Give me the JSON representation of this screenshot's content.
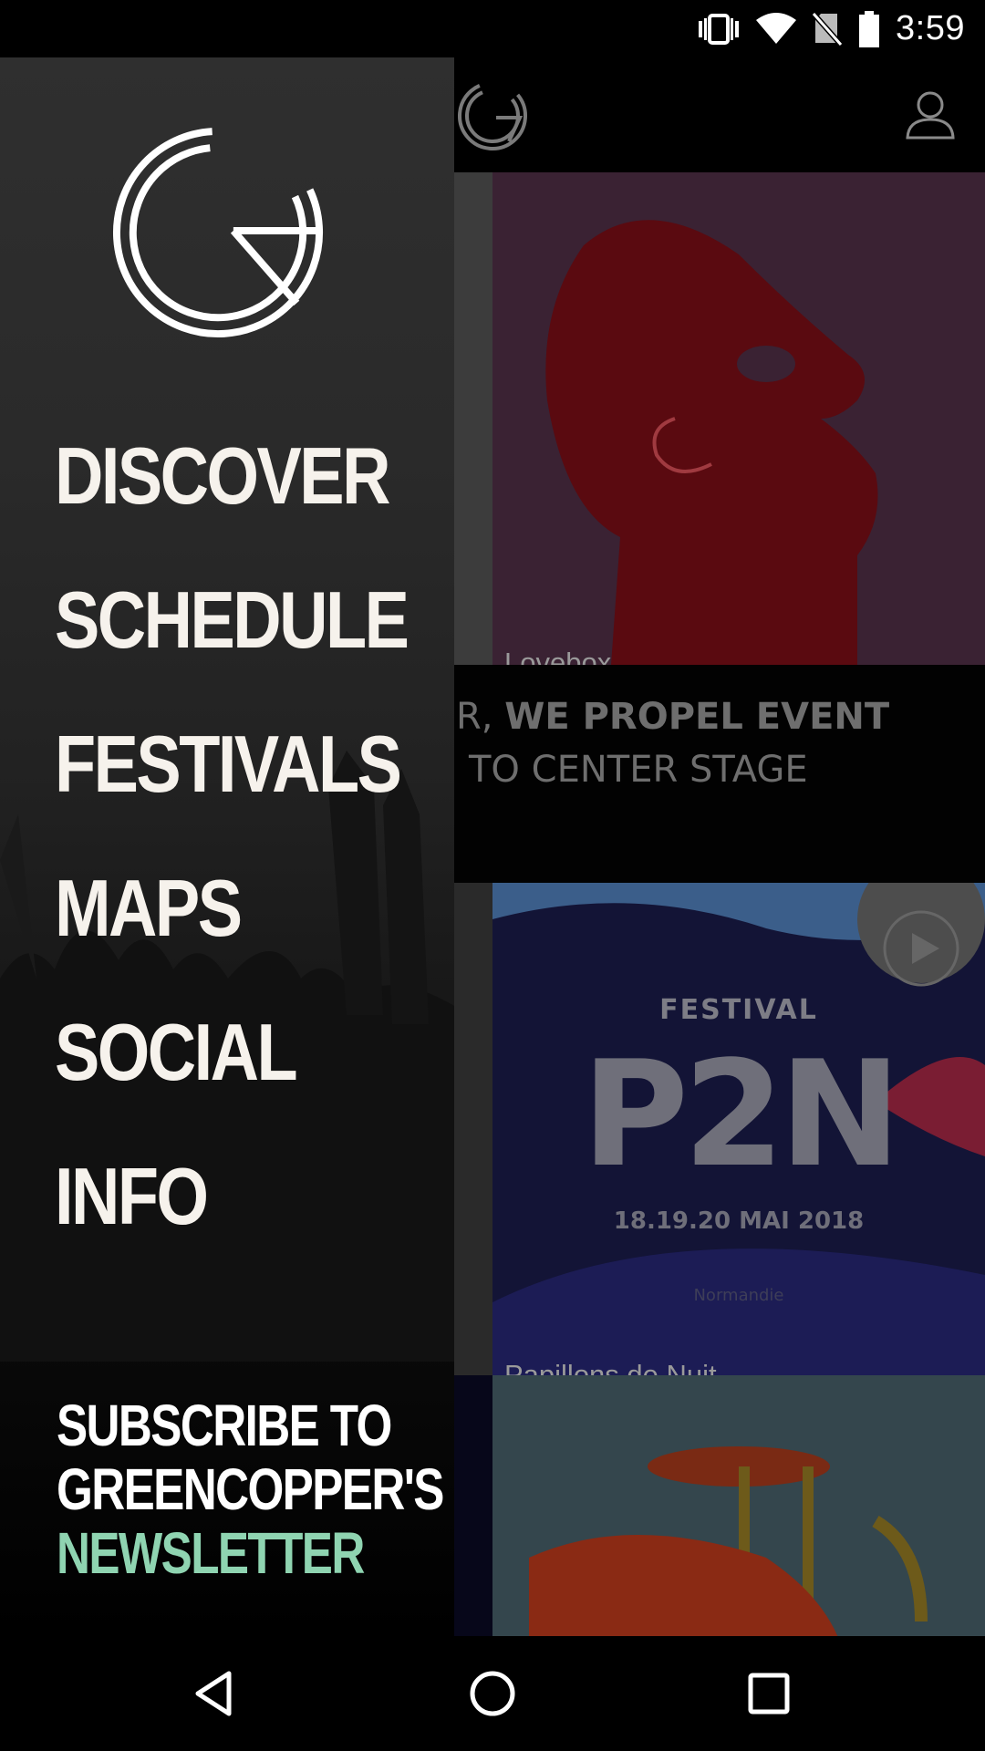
{
  "status_bar": {
    "time": "3:59",
    "icons": [
      "vibrate-icon",
      "wifi-icon",
      "no-sim-icon",
      "battery-icon"
    ]
  },
  "app": {
    "header": {
      "logo": "greencopper-logo",
      "profile_icon": "profile-icon"
    },
    "cards": [
      {
        "label": "Lovebox"
      },
      {
        "label": "Papillons de Nuit",
        "play_icon": "play-icon"
      }
    ],
    "banner": {
      "line1_light": "R,",
      "line1_bold": "WE PROPEL EVENT",
      "line2": "TO CENTER STAGE"
    },
    "p2n_poster": {
      "heading": "FESTIVAL",
      "name": "P2N",
      "dates": "18.19.20 MAI 2018",
      "region": "Normandie"
    }
  },
  "drawer": {
    "logo": "greencopper-logo",
    "menu": [
      {
        "label": "DISCOVER"
      },
      {
        "label": "SCHEDULE"
      },
      {
        "label": "FESTIVALS"
      },
      {
        "label": "MAPS"
      },
      {
        "label": "SOCIAL"
      },
      {
        "label": "INFO"
      }
    ],
    "subscribe": {
      "line1": "SUBSCRIBE TO",
      "line2": "GREENCOPPER'S",
      "line3": "NEWSLETTER"
    }
  },
  "colors": {
    "accent": "#8fd4b1",
    "menu_text": "#f6f2ec"
  },
  "nav_bar": {
    "icons": [
      "back-icon",
      "home-icon",
      "recents-icon"
    ]
  }
}
